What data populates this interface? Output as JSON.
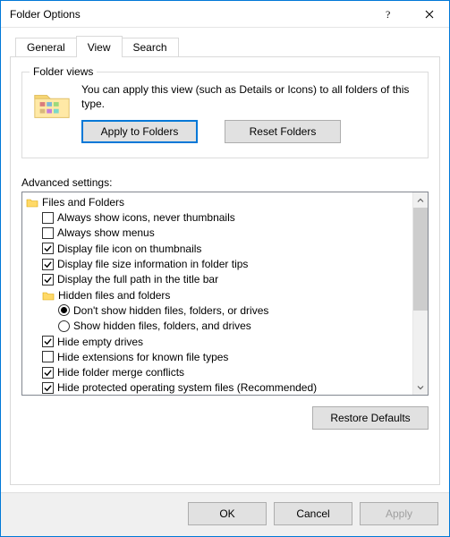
{
  "title": "Folder Options",
  "tabs": {
    "general": "General",
    "view": "View",
    "search": "Search"
  },
  "folderViews": {
    "groupTitle": "Folder views",
    "text": "You can apply this view (such as Details or Icons) to all folders of this type.",
    "applyBtn": "Apply to Folders",
    "resetBtn": "Reset Folders"
  },
  "advancedLabel": "Advanced settings:",
  "tree": {
    "filesAndFolders": "Files and Folders",
    "items": [
      {
        "label": "Always show icons, never thumbnails",
        "checked": false
      },
      {
        "label": "Always show menus",
        "checked": false
      },
      {
        "label": "Display file icon on thumbnails",
        "checked": true
      },
      {
        "label": "Display file size information in folder tips",
        "checked": true
      },
      {
        "label": "Display the full path in the title bar",
        "checked": true
      }
    ],
    "hiddenGroup": "Hidden files and folders",
    "hiddenOptions": [
      {
        "label": "Don't show hidden files, folders, or drives",
        "selected": true
      },
      {
        "label": "Show hidden files, folders, and drives",
        "selected": false
      }
    ],
    "items2": [
      {
        "label": "Hide empty drives",
        "checked": true
      },
      {
        "label": "Hide extensions for known file types",
        "checked": false
      },
      {
        "label": "Hide folder merge conflicts",
        "checked": true
      },
      {
        "label": "Hide protected operating system files (Recommended)",
        "checked": true
      }
    ]
  },
  "restoreDefaults": "Restore Defaults",
  "buttons": {
    "ok": "OK",
    "cancel": "Cancel",
    "apply": "Apply"
  }
}
